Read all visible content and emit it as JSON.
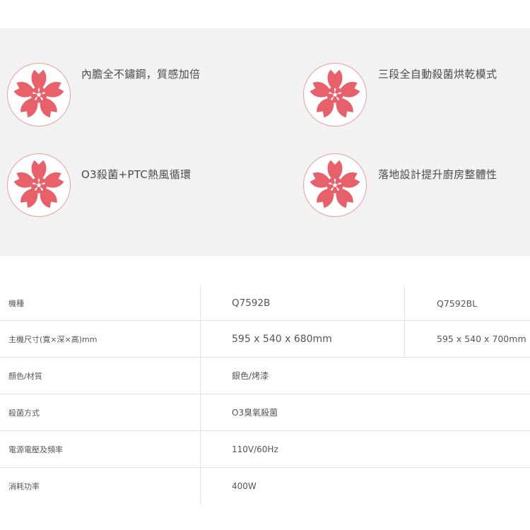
{
  "colors": {
    "feature_background": "#f2f2f2",
    "flower_fill": "#e8606a",
    "badge_border": "#e6a0a0"
  },
  "features": [
    {
      "icon": "sakura-flower-icon",
      "text": "內膽全不鏽鋼，質感加倍"
    },
    {
      "icon": "sakura-flower-icon",
      "text": "三段全自動殺菌烘乾模式"
    },
    {
      "icon": "sakura-flower-icon",
      "text": "O3殺菌+PTC熱風循環"
    },
    {
      "icon": "sakura-flower-icon",
      "text": "落地設計提升廚房整體性"
    }
  ],
  "spec_table": {
    "rows": [
      {
        "label": "機種",
        "value1": "Q7592B",
        "value2": "Q7592BL"
      },
      {
        "label": "主機尺寸(寬×深×高)mm",
        "value1": "595 x 540 x 680mm",
        "value2": "595 x 540 x 700mm"
      },
      {
        "label": "顏色/材質",
        "value1": "銀色/烤漆"
      },
      {
        "label": "殺菌方式",
        "value1": "O3臭氧殺菌"
      },
      {
        "label": "電源電壓及頻率",
        "value1": "110V/60Hz"
      },
      {
        "label": "消耗功率",
        "value1": "400W"
      }
    ]
  }
}
